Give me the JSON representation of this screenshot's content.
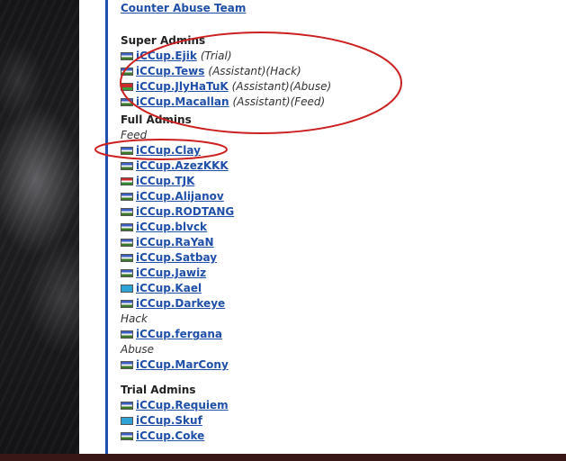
{
  "top_link": "Counter Abuse Team",
  "sections": [
    {
      "title": "Super Admins",
      "groups": [
        {
          "subheading": "",
          "members": [
            {
              "name": "iCCup.Ejik",
              "roles": "(Trial)",
              "flag": "kz"
            },
            {
              "name": "iCCup.Tews",
              "roles": "(Assistant)(Hack)",
              "flag": "kz"
            },
            {
              "name": "iCCup.JlyHaTuK",
              "roles": "(Assistant)(Abuse)",
              "flag": "by"
            },
            {
              "name": "iCCup.Macallan",
              "roles": "(Assistant)(Feed)",
              "flag": "kz"
            }
          ]
        }
      ]
    },
    {
      "title": "Full Admins",
      "groups": [
        {
          "subheading": "Feed",
          "members": [
            {
              "name": "iCCup.Clay",
              "roles": "",
              "flag": "kz"
            },
            {
              "name": "iCCup.AzezKKK",
              "roles": "",
              "flag": "kz"
            },
            {
              "name": "iCCup.TJK",
              "roles": "",
              "flag": "tj"
            },
            {
              "name": "iCCup.Alijanov",
              "roles": "",
              "flag": "kz"
            },
            {
              "name": "iCCup.RODTANG",
              "roles": "",
              "flag": "kz"
            },
            {
              "name": "iCCup.blvck",
              "roles": "",
              "flag": "kz"
            },
            {
              "name": "iCCup.RaYaN",
              "roles": "",
              "flag": "kz"
            },
            {
              "name": "iCCup.Satbay",
              "roles": "",
              "flag": "kz"
            },
            {
              "name": "iCCup.Jawiz",
              "roles": "",
              "flag": "kz"
            },
            {
              "name": "iCCup.Kael",
              "roles": "",
              "flag": "kz2"
            },
            {
              "name": "iCCup.Darkeye",
              "roles": "",
              "flag": "kz"
            }
          ]
        },
        {
          "subheading": "Hack",
          "members": [
            {
              "name": "iCCup.fergana",
              "roles": "",
              "flag": "kz"
            }
          ]
        },
        {
          "subheading": "Abuse",
          "members": [
            {
              "name": "iCCup.MarCony",
              "roles": "",
              "flag": "kz"
            }
          ]
        }
      ]
    },
    {
      "title": "Trial Admins",
      "groups": [
        {
          "subheading": "",
          "members": [
            {
              "name": "iCCup.Requiem",
              "roles": "",
              "flag": "kz"
            },
            {
              "name": "iCCup.Skuf",
              "roles": "",
              "flag": "kz2"
            },
            {
              "name": "iCCup.Coke",
              "roles": "",
              "flag": "kz"
            }
          ]
        }
      ]
    }
  ],
  "flag_styles": {
    "kz": "linear-gradient(180deg,#3b5fc4 0 33%,#f2f2f2 33% 66%,#3b7a2a 66% 100%)",
    "kz2": "linear-gradient(180deg,#2fa3d6 0 100%)",
    "by": "linear-gradient(180deg,#c92a2a 0 60%,#3a9b3a 60% 100%)",
    "tj": "linear-gradient(180deg,#c92a2a 0 33%,#ffffff 33% 66%,#2c8a2c 66% 100%)"
  },
  "annotation_color": "#cc1f1f"
}
